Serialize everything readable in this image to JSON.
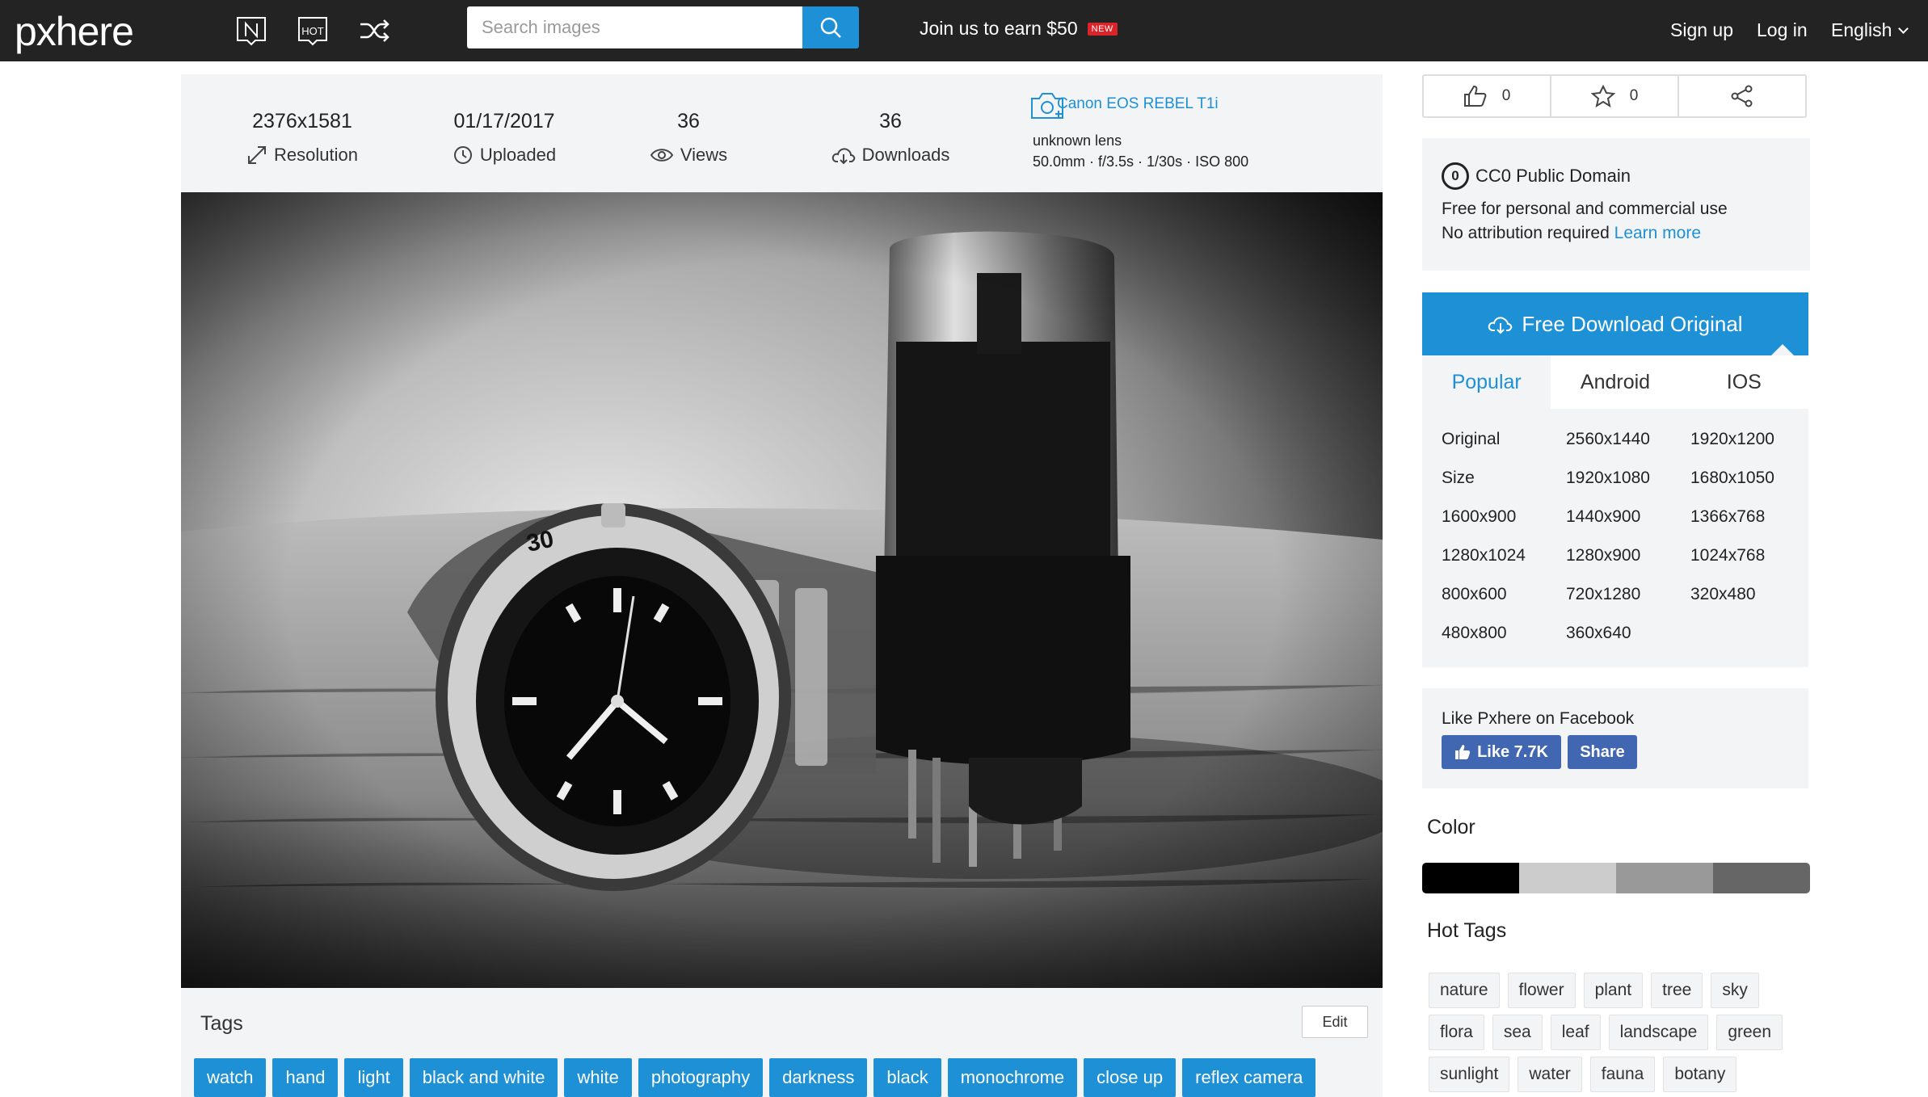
{
  "header": {
    "logo": "pxhere",
    "search_placeholder": "Search images",
    "earn_text": "Join us to earn $50",
    "new_badge": "NEW",
    "sign_up": "Sign up",
    "log_in": "Log in",
    "language": "English",
    "icons": [
      "new-icon",
      "hot-icon",
      "shuffle-icon",
      "search-icon"
    ]
  },
  "stats": {
    "resolution": {
      "value": "2376x1581",
      "label": "Resolution"
    },
    "uploaded": {
      "value": "01/17/2017",
      "label": "Uploaded"
    },
    "views": {
      "value": "36",
      "label": "Views"
    },
    "downloads": {
      "value": "36",
      "label": "Downloads"
    },
    "camera": {
      "name": "Canon EOS REBEL T1i",
      "lens": "unknown lens",
      "exif": "50.0mm · f/3.5s · 1/30s · ISO 800"
    }
  },
  "tags": {
    "title": "Tags",
    "edit_label": "Edit",
    "items": [
      "watch",
      "hand",
      "light",
      "black and white",
      "white",
      "photography",
      "darkness",
      "black",
      "monochrome",
      "close up",
      "reflex camera"
    ]
  },
  "actions": {
    "likes": "0",
    "favorites": "0"
  },
  "license": {
    "title": "CC0 Public Domain",
    "badge": "0",
    "line1": "Free for personal and commercial use",
    "line2": "No attribution required",
    "learn_more": "Learn more"
  },
  "download": {
    "button_label": "Free Download Original",
    "tabs": [
      "Popular",
      "Android",
      "IOS"
    ],
    "sizes": [
      "Original",
      "2560x1440",
      "1920x1200",
      "Size",
      "1920x1080",
      "1680x1050",
      "1600x900",
      "1440x900",
      "1366x768",
      "1280x1024",
      "1280x900",
      "1024x768",
      "800x600",
      "720x1280",
      "320x480",
      "480x800",
      "360x640"
    ]
  },
  "facebook": {
    "title": "Like Pxhere on Facebook",
    "like_label": "Like 7.7K",
    "share_label": "Share"
  },
  "color": {
    "title": "Color",
    "swatches": [
      "#000000",
      "#cccccc",
      "#999999",
      "#666666"
    ]
  },
  "hot_tags": {
    "title": "Hot Tags",
    "items": [
      "nature",
      "flower",
      "plant",
      "tree",
      "sky",
      "flora",
      "sea",
      "leaf",
      "landscape",
      "green",
      "sunlight",
      "water",
      "fauna",
      "botany"
    ]
  },
  "colors": {
    "accent": "#1e90d6",
    "header_bg": "#232323",
    "panel_bg": "#f3f4f6",
    "facebook": "#4267b2",
    "badge_red": "#d9252a"
  }
}
